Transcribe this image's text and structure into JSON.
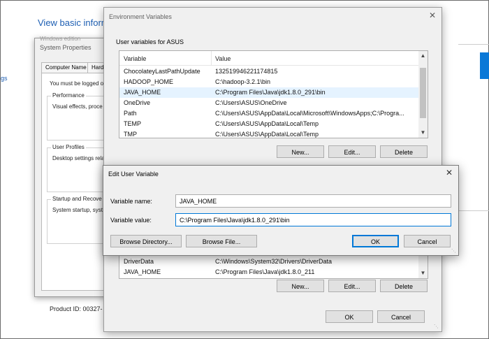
{
  "background": {
    "heading": "View basic inform",
    "left_link": "gs",
    "product_id": "Product ID: 00327-"
  },
  "system_properties": {
    "ghost_title": "Windows edition",
    "title": "System Properties",
    "tabs": [
      "Computer Name",
      "Hardw"
    ],
    "admin_note": "You must be logged o",
    "performance_label": "Performance",
    "performance_text": "Visual effects, proce",
    "user_profiles_label": "User Profiles",
    "user_profiles_text": "Desktop settings rela",
    "startup_label": "Startup and Recove",
    "startup_text": "System startup, syst"
  },
  "env_vars": {
    "title": "Environment Variables",
    "close_glyph": "✕",
    "user_section_label": "User variables for ASUS",
    "columns": {
      "variable": "Variable",
      "value": "Value"
    },
    "user_vars": [
      {
        "name": "ChocolateyLastPathUpdate",
        "value": "132519946221174815"
      },
      {
        "name": "HADOOP_HOME",
        "value": "C:\\hadoop-3.2.1\\bin"
      },
      {
        "name": "JAVA_HOME",
        "value": "C:\\Program Files\\Java\\jdk1.8.0_291\\bin"
      },
      {
        "name": "OneDrive",
        "value": "C:\\Users\\ASUS\\OneDrive"
      },
      {
        "name": "Path",
        "value": "C:\\Users\\ASUS\\AppData\\Local\\Microsoft\\WindowsApps;C:\\Progra..."
      },
      {
        "name": "TEMP",
        "value": "C:\\Users\\ASUS\\AppData\\Local\\Temp"
      },
      {
        "name": "TMP",
        "value": "C:\\Users\\ASUS\\AppData\\Local\\Temp"
      }
    ],
    "selected_index": 2,
    "user_buttons": {
      "new": "New...",
      "edit": "Edit...",
      "delete": "Delete"
    },
    "system_vars": [
      {
        "name": "DriverData",
        "value": "C:\\Windows\\System32\\Drivers\\DriverData"
      },
      {
        "name": "JAVA_HOME",
        "value": "C:\\Program Files\\Java\\jdk1.8.0_211"
      }
    ],
    "system_buttons": {
      "new": "New...",
      "edit": "Edit...",
      "delete": "Delete"
    },
    "ok": "OK",
    "cancel": "Cancel"
  },
  "edit_dialog": {
    "title": "Edit User Variable",
    "close_glyph": "✕",
    "name_label": "Variable name:",
    "name_value": "JAVA_HOME",
    "value_label": "Variable value:",
    "value_value": "C:\\Program Files\\Java\\jdk1.8.0_291\\bin",
    "browse_directory": "Browse Directory...",
    "browse_file": "Browse File...",
    "ok": "OK",
    "cancel": "Cancel"
  },
  "colors": {
    "accent": "#0078d7",
    "link": "#1e5fb3",
    "selection": "#e5f3ff",
    "dialog_bg": "#f0f0f0"
  }
}
